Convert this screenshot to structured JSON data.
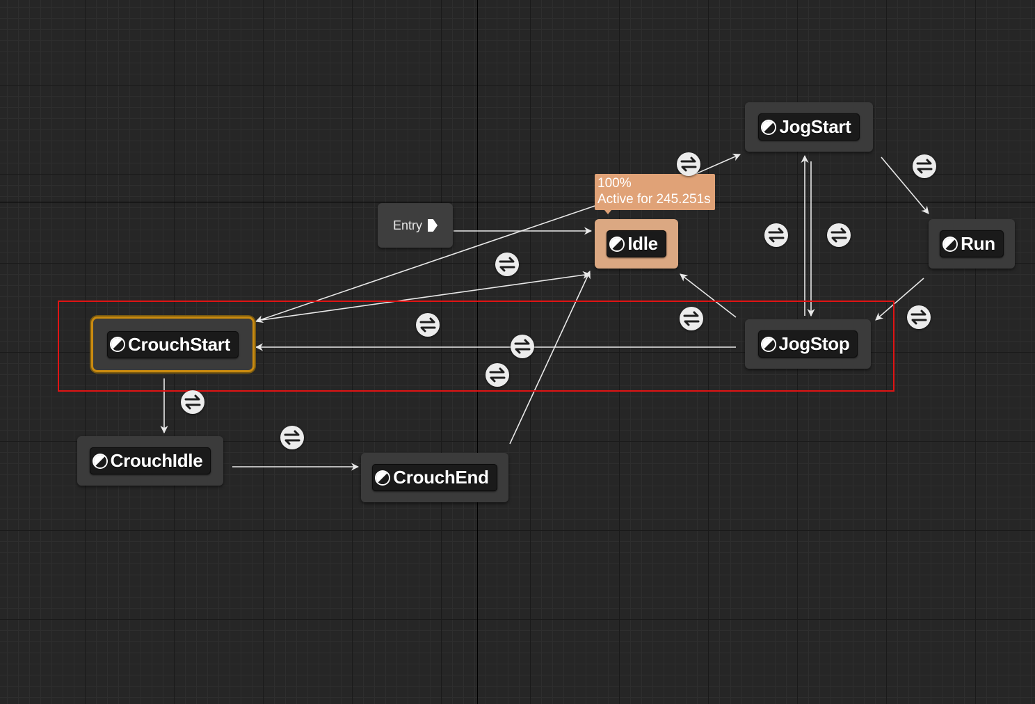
{
  "graph": {
    "entry": {
      "label": "Entry",
      "icon": "entry-arrow-icon"
    },
    "states": {
      "idle": "Idle",
      "jog_start": "JogStart",
      "run": "Run",
      "jog_stop": "JogStop",
      "crouch_start": "CrouchStart",
      "crouch_idle": "CrouchIdle",
      "crouch_end": "CrouchEnd"
    },
    "state_icon": "state-machine-icon",
    "transition_icon": "transition-rule-icon",
    "active_state": "Idle",
    "selected_state": "CrouchStart",
    "debug_tooltip": {
      "weight": "100%",
      "active_time": "Active for 245.251s"
    }
  },
  "colors": {
    "background": "#262626",
    "active_state": "#dba882",
    "tooltip": "#e0a277",
    "selected_outline": "#c98a10",
    "selection_box": "#e01414"
  }
}
